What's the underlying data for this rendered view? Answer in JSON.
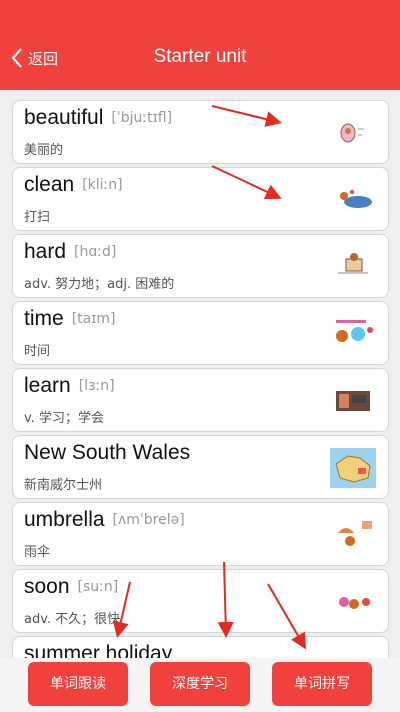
{
  "header": {
    "back_label": "返回",
    "title": "Starter unit",
    "color": "#f1413d"
  },
  "words": [
    {
      "word": "beautiful",
      "phonetic": "[ˈbjuːtɪfl]",
      "meaning": "美丽的",
      "thumb_icon": "beautiful-thumbnail"
    },
    {
      "word": "clean",
      "phonetic": "[kliːn]",
      "meaning": "打扫",
      "thumb_icon": "clean-thumbnail"
    },
    {
      "word": "hard",
      "phonetic": "[hɑːd]",
      "meaning": "adv. 努力地；adj. 困难的",
      "thumb_icon": "hard-thumbnail"
    },
    {
      "word": "time",
      "phonetic": "[taɪm]",
      "meaning": "时间",
      "thumb_icon": "time-thumbnail"
    },
    {
      "word": "learn",
      "phonetic": "[lɜːn]",
      "meaning": "v. 学习；学会",
      "thumb_icon": "learn-thumbnail"
    },
    {
      "word": "New South Wales",
      "phonetic": "",
      "meaning": "新南威尔士州",
      "thumb_icon": "map-thumbnail"
    },
    {
      "word": "umbrella",
      "phonetic": "[ʌmˈbrelə]",
      "meaning": "雨伞",
      "thumb_icon": "umbrella-thumbnail"
    },
    {
      "word": "soon",
      "phonetic": "[suːn]",
      "meaning": "adv. 不久；很快",
      "thumb_icon": "soon-thumbnail"
    },
    {
      "word": "summer holiday",
      "phonetic": "",
      "meaning": "",
      "thumb_icon": "summer-holiday-thumbnail"
    }
  ],
  "bottom_bar": {
    "follow_read_label": "单词跟读",
    "deep_study_label": "深度学习",
    "spell_label": "单词拼写"
  }
}
